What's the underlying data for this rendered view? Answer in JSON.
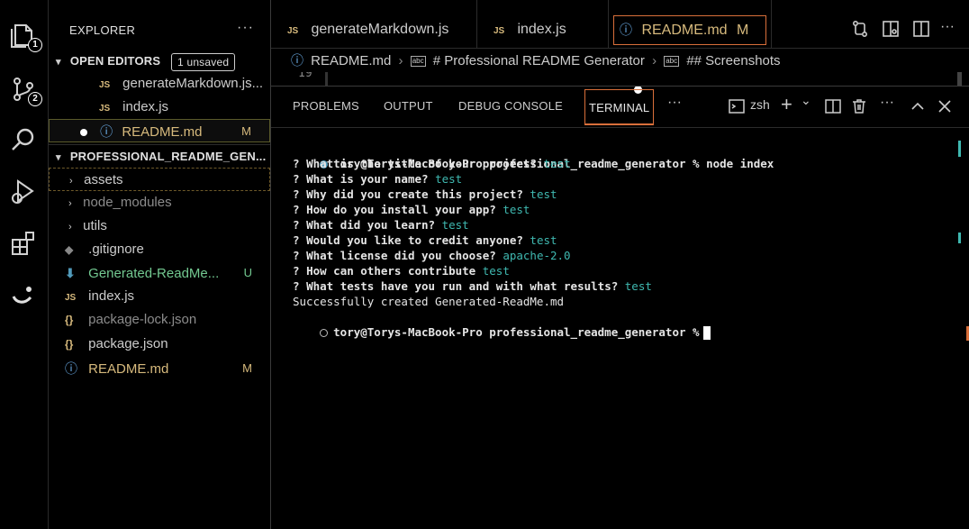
{
  "sidebar": {
    "title": "EXPLORER",
    "more": "···",
    "open_editors": {
      "label": "OPEN EDITORS",
      "badge": "1 unsaved",
      "items": [
        {
          "icon": "JS",
          "name": "generateMarkdown.js...",
          "status": ""
        },
        {
          "icon": "JS",
          "name": "index.js",
          "status": ""
        },
        {
          "icon": "ⓘ",
          "name": "README.md",
          "status": "M"
        }
      ]
    },
    "project": {
      "label": "PROFESSIONAL_README_GEN...",
      "items": [
        {
          "name": "assets",
          "kind": "folder"
        },
        {
          "name": "node_modules",
          "kind": "folder"
        },
        {
          "name": "utils",
          "kind": "folder"
        },
        {
          "name": ".gitignore",
          "kind": "file"
        },
        {
          "name": "Generated-ReadMe...",
          "kind": "file",
          "status": "U"
        },
        {
          "name": "index.js",
          "kind": "file"
        },
        {
          "name": "package-lock.json",
          "kind": "file"
        },
        {
          "name": "package.json",
          "kind": "file"
        },
        {
          "name": "README.md",
          "kind": "file",
          "status": "M"
        }
      ]
    },
    "chevron_down": "⌄",
    "chevron_right": "›",
    "json_icon": "{}",
    "info_icon": "ⓘ",
    "git_icon": "◆"
  },
  "activity": {
    "explorer_badge": "1",
    "scm_badge": "2"
  },
  "tabs": [
    {
      "icon": "JS",
      "label": "generateMarkdown.js"
    },
    {
      "icon": "JS",
      "label": "index.js"
    },
    {
      "icon": "ⓘ",
      "label": "README.md",
      "status": "M",
      "active": true
    }
  ],
  "breadcrumb": {
    "file": "README.md",
    "h1": "# Professional README Generator",
    "h2": "## Screenshots",
    "abc": "abc"
  },
  "editor": {
    "line_number": "19"
  },
  "panel": {
    "tabs": [
      "PROBLEMS",
      "OUTPUT",
      "DEBUG CONSOLE",
      "TERMINAL"
    ],
    "more": "···",
    "shell": "zsh",
    "plus": "+",
    "chev": "⌄"
  },
  "terminal": {
    "prompt1": "tory@Torys-MacBook-Pro professional_readme_generator % node index",
    "qa": [
      {
        "q": "What is the title of your project?",
        "a": "test"
      },
      {
        "q": "What is your name?",
        "a": "test"
      },
      {
        "q": "Why did you create this project?",
        "a": "test"
      },
      {
        "q": "How do you install your app?",
        "a": "test"
      },
      {
        "q": "What did you learn?",
        "a": "test"
      },
      {
        "q": "Would you like to credit anyone?",
        "a": "test"
      },
      {
        "q": "What license did you choose?",
        "a": "apache-2.0"
      },
      {
        "q": "How can others contribute",
        "a": "test"
      },
      {
        "q": "What tests have you run and with what results?",
        "a": "test"
      }
    ],
    "qmark": "?",
    "success": "Successfully created Generated-ReadMe.md",
    "prompt2": "tory@Torys-MacBook-Pro professional_readme_generator %"
  },
  "colors": {
    "accent": "#d96f3a",
    "modified": "#d7ba7d",
    "untracked": "#73c991",
    "answer": "#3fb8b0"
  }
}
